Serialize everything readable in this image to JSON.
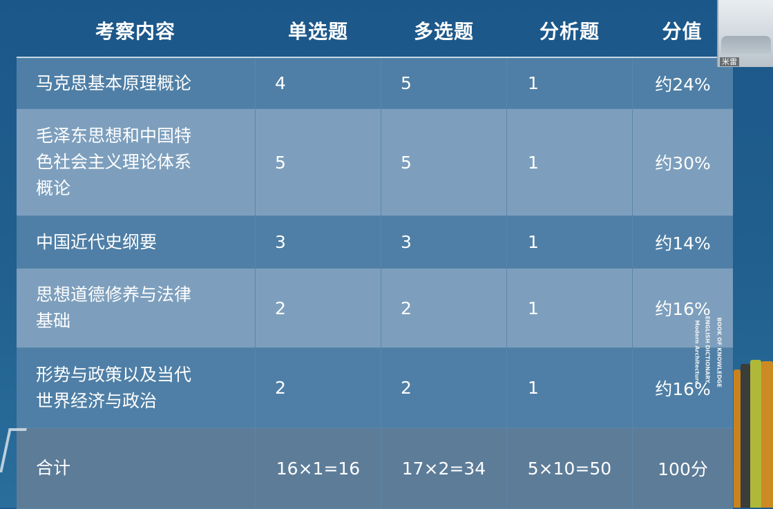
{
  "header": {
    "c0": "考察内容",
    "c1": "单选题",
    "c2": "多选题",
    "c3": "分析题",
    "c4": "分值"
  },
  "rows": [
    {
      "subject_lines": [
        "马克思基本原理概论"
      ],
      "single": "4",
      "multi": "5",
      "analysis": "1",
      "score": "约24%"
    },
    {
      "subject_lines": [
        "毛泽东思想和中国特",
        "色社会主义理论体系",
        "概论"
      ],
      "single": "5",
      "multi": "5",
      "analysis": "1",
      "score": "约30%"
    },
    {
      "subject_lines": [
        "中国近代史纲要"
      ],
      "single": "3",
      "multi": "3",
      "analysis": "1",
      "score": "约14%"
    },
    {
      "subject_lines": [
        "思想道德修养与法律",
        "基础"
      ],
      "single": "2",
      "multi": "2",
      "analysis": "1",
      "score": "约16%"
    },
    {
      "subject_lines": [
        "形势与政策以及当代",
        "世界经济与政治"
      ],
      "single": "2",
      "multi": "2",
      "analysis": "1",
      "score": "约16%"
    }
  ],
  "total": {
    "label": "合计",
    "single": "16×1=16",
    "multi": "17×2=34",
    "analysis": "5×10=50",
    "score": "100分"
  },
  "webcam": {
    "name": "米雷"
  },
  "books": {
    "spine_1": "Modern Architecture",
    "spine_2": "ENGLISH DICTIONARY",
    "spine_3": "BOOK OF KNOWLEDGE"
  },
  "colors": {
    "background": "#1f5c8e",
    "row_dark": "#4f7fa6",
    "row_light": "#7d9fbd",
    "row_total": "#5d7c98",
    "text": "#ffffff"
  }
}
